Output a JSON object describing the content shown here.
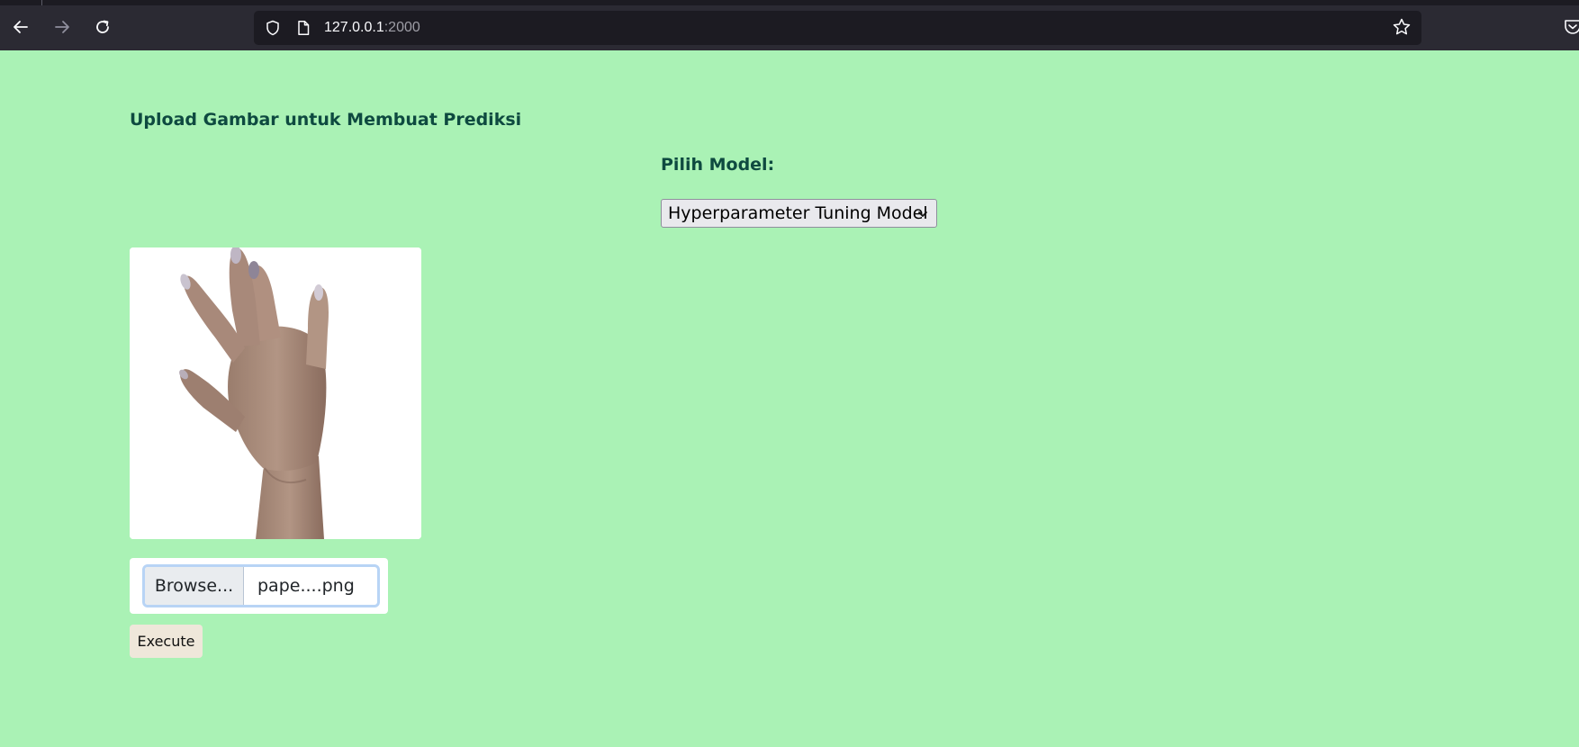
{
  "browser": {
    "url_host": "127.0.0.1",
    "url_port": ":2000"
  },
  "page": {
    "heading": "Upload Gambar untuk Membuat Prediksi",
    "model_label": "Pilih Model:",
    "model_select_value": "Hyperparameter Tuning Model",
    "browse_label": "Browse...",
    "file_name": "pape....png",
    "execute_label": "Execute"
  },
  "colors": {
    "page_background": "#aaf2b5",
    "heading_text": "#0e4a40",
    "execute_button": "#efe7da"
  },
  "icons": {
    "back": "back-arrow-icon",
    "forward": "forward-arrow-icon",
    "reload": "reload-icon",
    "shield": "shield-icon",
    "page": "page-icon",
    "bookmark": "star-icon",
    "pocket": "pocket-icon",
    "select_chevron": "chevron-down-icon"
  },
  "preview_image": "hand-image"
}
